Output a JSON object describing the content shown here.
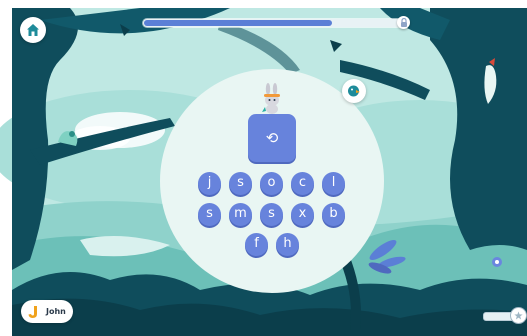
{
  "user": {
    "name": "John",
    "initial": "J"
  },
  "progress": {
    "fraction": 0.73
  },
  "stars": {
    "fraction": 0.0
  },
  "replay": {
    "glyph": "⟲"
  },
  "letters": [
    {
      "label": "j"
    },
    {
      "label": "s"
    },
    {
      "label": "o"
    },
    {
      "label": "c"
    },
    {
      "label": "l"
    },
    {
      "label": "s"
    },
    {
      "label": "m"
    },
    {
      "label": "s"
    },
    {
      "label": "x"
    },
    {
      "label": "b"
    },
    {
      "label": "f"
    },
    {
      "label": "h"
    }
  ],
  "colors": {
    "accent": "#6783dc",
    "home_icon": "#1e8b9a",
    "user_initial": "#f0a21c",
    "background_sky": "#b9e7e2",
    "forest_dark": "#0f4d5c"
  },
  "icons": {
    "home": "house-icon",
    "lock": "lock-icon",
    "hint": "parrot-icon",
    "replay": "replay-arrow-icon",
    "stars": "star-icon"
  }
}
